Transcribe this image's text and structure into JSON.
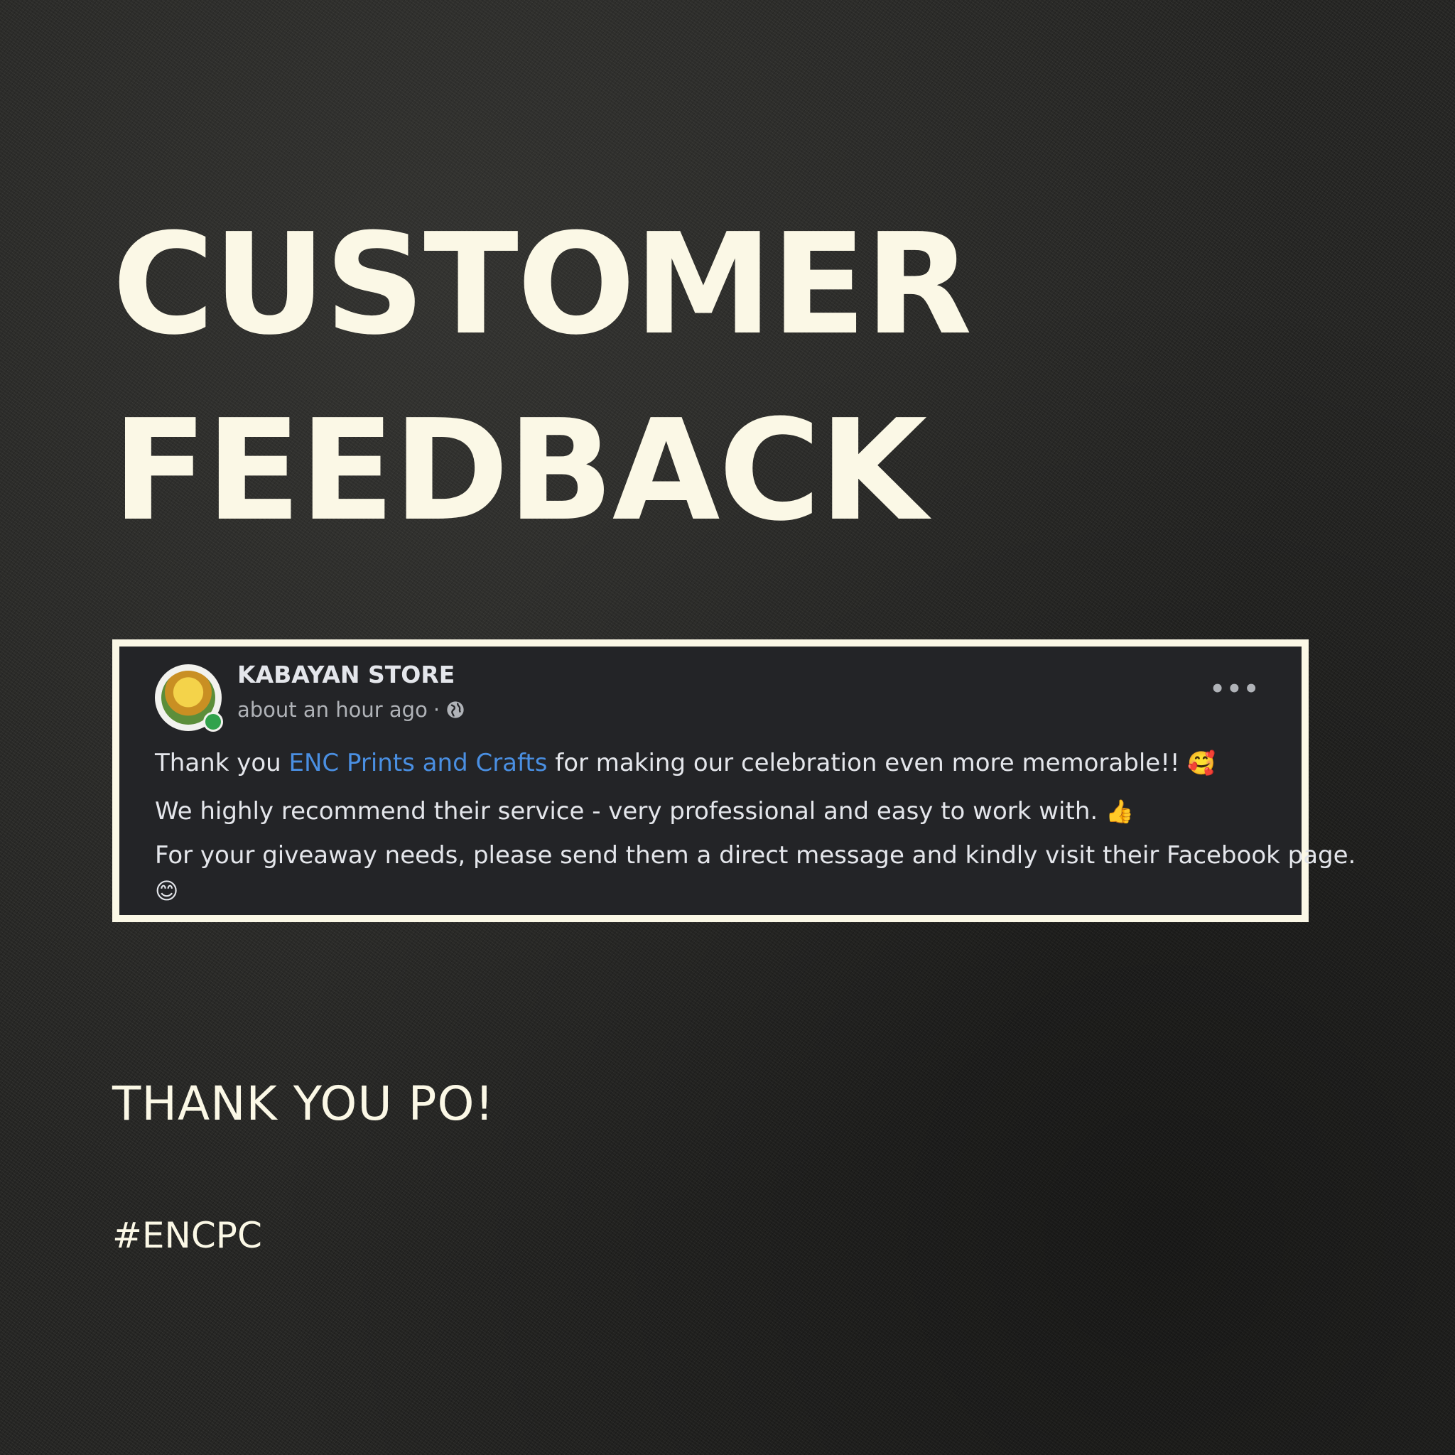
{
  "headline": {
    "line1": "CUSTOMER",
    "line2": "FEEDBACK"
  },
  "post": {
    "author": "KABAYAN STORE",
    "time": "about an hour ago",
    "separator": "·",
    "mention": "ENC Prints and Crafts",
    "line1_before": "Thank you ",
    "line1_after": " for making our celebration even more memorable!! ",
    "line1_emoji": "🥰",
    "line2": "We highly recommend their service - very professional and easy to work with. ",
    "line2_emoji": "👍",
    "line3": "For your giveaway needs, please send them a direct message and kindly visit their Facebook page.",
    "line4_emoji": "😊",
    "more_glyph": "•••"
  },
  "footer": {
    "thanks": "THANK YOU PO!",
    "hashtag": "#ENCPC"
  },
  "colors": {
    "cream": "#fbf8e6",
    "post_bg": "#232427",
    "link": "#4a8fe2",
    "online": "#31a24c"
  },
  "icons": [
    "globe-icon",
    "more-options-icon",
    "online-status-icon"
  ]
}
